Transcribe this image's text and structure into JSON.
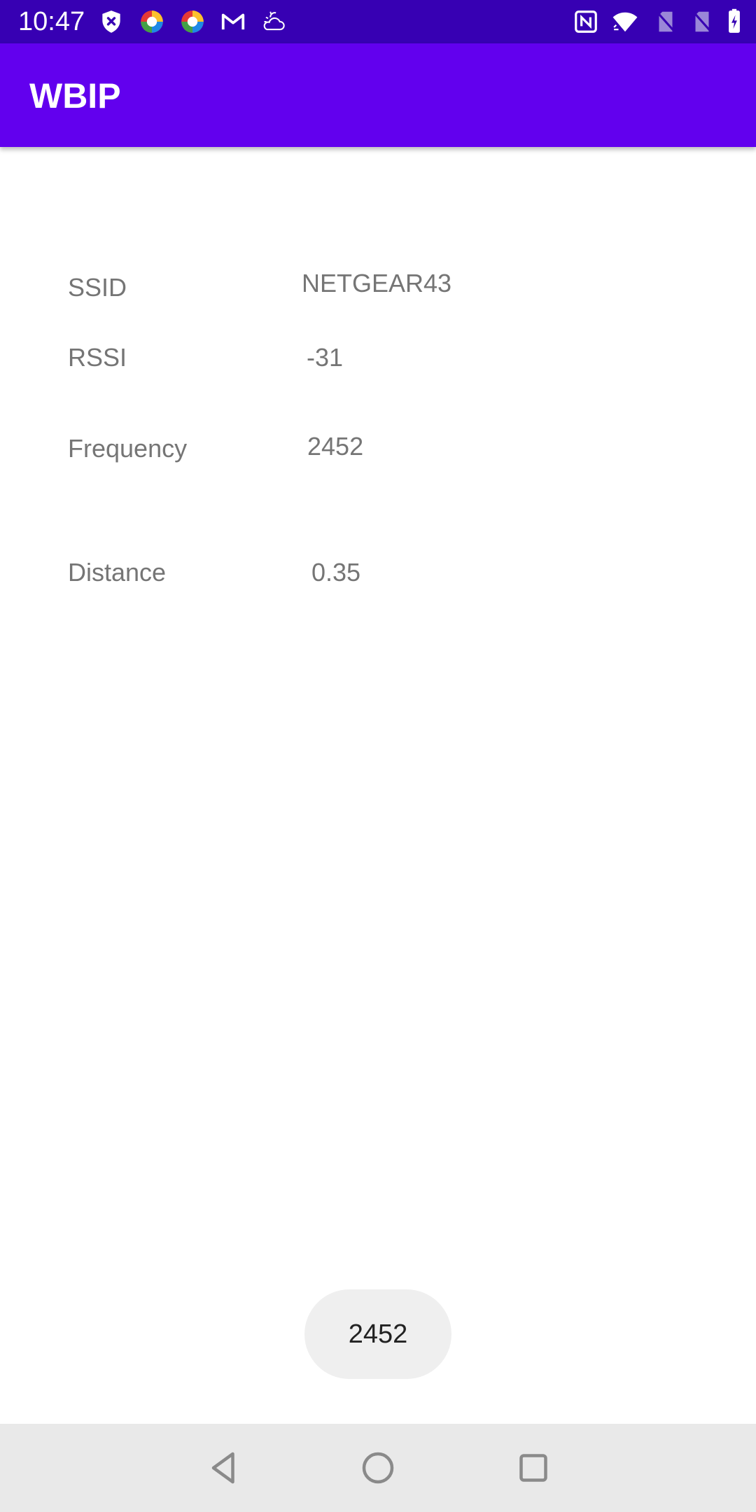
{
  "status_bar": {
    "time": "10:47",
    "left_icons": [
      "shield-x-icon",
      "app-circle-icon",
      "app-circle-icon",
      "gmail-icon",
      "cloudy-night-icon"
    ],
    "right_icons": [
      "nfc-icon",
      "wifi-icon",
      "no-sim-icon",
      "no-sim-icon",
      "battery-charging-icon"
    ],
    "background_color": "#3700b3"
  },
  "app_bar": {
    "title": "WBIP",
    "background_color": "#6200ee"
  },
  "fields": {
    "ssid": {
      "label": "SSID",
      "value": "NETGEAR43"
    },
    "rssi": {
      "label": "RSSI",
      "value": "-31"
    },
    "frequency": {
      "label": "Frequency",
      "value": "2452"
    },
    "distance": {
      "label": "Distance",
      "value": "0.35"
    }
  },
  "toast": {
    "text": "2452"
  },
  "nav_bar": {
    "buttons": [
      "back-icon",
      "home-icon",
      "recents-icon"
    ]
  }
}
